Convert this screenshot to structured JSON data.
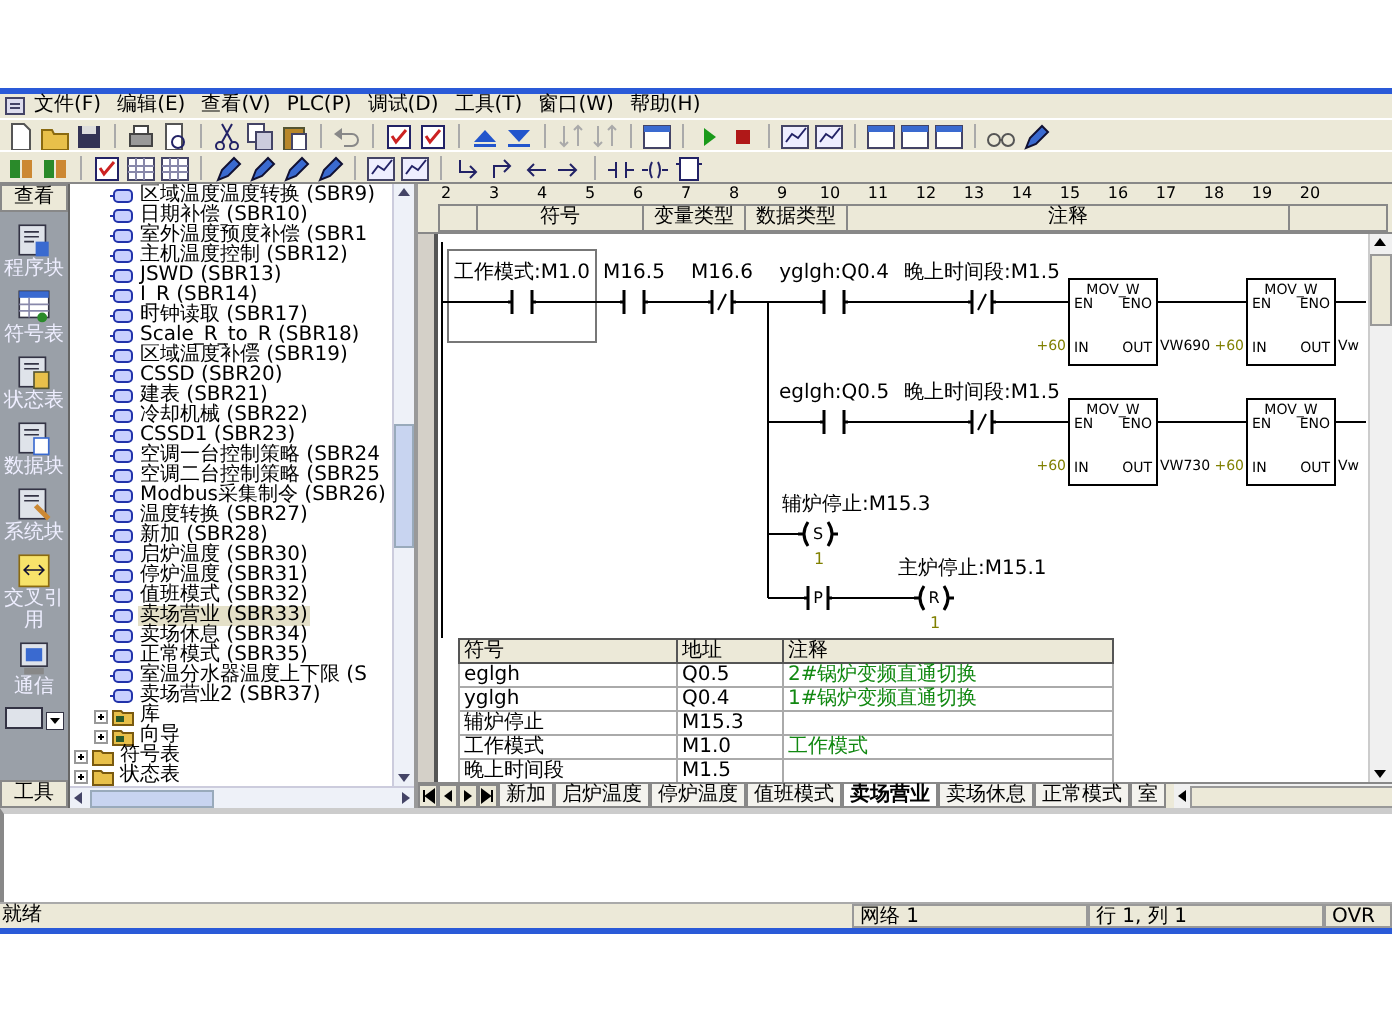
{
  "menu": [
    "文件(F)",
    "编辑(E)",
    "查看(V)",
    "PLC(P)",
    "调试(D)",
    "工具(T)",
    "窗口(W)",
    "帮助(H)"
  ],
  "navbar": {
    "title": "查看",
    "items": [
      "程序块",
      "符号表",
      "状态表",
      "数据块",
      "系统块",
      "交叉引用",
      "通信"
    ],
    "footer": "工具"
  },
  "tree": {
    "sub_items": [
      {
        "kind": "subroutine",
        "label": "区域温度温度转换 (SBR9)",
        "selected": false
      },
      {
        "kind": "subroutine",
        "label": "日期补偿 (SBR10)",
        "selected": false
      },
      {
        "kind": "subroutine",
        "label": "室外温度预度补偿 (SBR1",
        "selected": false
      },
      {
        "kind": "subroutine",
        "label": "主机温度控制 (SBR12)",
        "selected": false
      },
      {
        "kind": "subroutine",
        "label": "JSWD (SBR13)",
        "selected": false
      },
      {
        "kind": "subroutine",
        "label": "I_R (SBR14)",
        "selected": false
      },
      {
        "kind": "subroutine",
        "label": "时钟读取 (SBR17)",
        "selected": false
      },
      {
        "kind": "subroutine",
        "label": "Scale_R_to_R (SBR18)",
        "selected": false
      },
      {
        "kind": "subroutine",
        "label": "区域温度补偿 (SBR19)",
        "selected": false
      },
      {
        "kind": "subroutine",
        "label": "CSSD (SBR20)",
        "selected": false
      },
      {
        "kind": "subroutine",
        "label": "建表 (SBR21)",
        "selected": false
      },
      {
        "kind": "subroutine",
        "label": "冷却机械 (SBR22)",
        "selected": false
      },
      {
        "kind": "subroutine",
        "label": "CSSD1 (SBR23)",
        "selected": false
      },
      {
        "kind": "subroutine",
        "label": "空调一台控制策略 (SBR24",
        "selected": false
      },
      {
        "kind": "subroutine",
        "label": "空调二台控制策略 (SBR25",
        "selected": false
      },
      {
        "kind": "subroutine",
        "label": "Modbus采集制令 (SBR26)",
        "selected": false
      },
      {
        "kind": "subroutine",
        "label": "温度转换 (SBR27)",
        "selected": false
      },
      {
        "kind": "subroutine",
        "label": "新加 (SBR28)",
        "selected": false
      },
      {
        "kind": "subroutine",
        "label": "启炉温度 (SBR30)",
        "selected": false
      },
      {
        "kind": "subroutine",
        "label": "停炉温度 (SBR31)",
        "selected": false
      },
      {
        "kind": "subroutine",
        "label": "值班模式 (SBR32)",
        "selected": false
      },
      {
        "kind": "subroutine",
        "label": "卖场营业 (SBR33)",
        "selected": true
      },
      {
        "kind": "subroutine",
        "label": "卖场休息 (SBR34)",
        "selected": false
      },
      {
        "kind": "subroutine",
        "label": "正常模式 (SBR35)",
        "selected": false
      },
      {
        "kind": "subroutine",
        "label": "室温分水器温度上下限 (S",
        "selected": false
      },
      {
        "kind": "subroutine",
        "label": "卖场营业2 (SBR37)",
        "selected": false
      },
      {
        "kind": "folder",
        "label": "库",
        "expanded": false
      },
      {
        "kind": "folder",
        "label": "向导",
        "expanded": false
      }
    ],
    "top_items": [
      {
        "label": "符号表",
        "expanded": false
      },
      {
        "label": "状态表",
        "expanded": false
      }
    ]
  },
  "editor": {
    "ruler": [
      "2",
      "3",
      "4",
      "5",
      "6",
      "7",
      "8",
      "9",
      "10",
      "11",
      "12",
      "13",
      "14",
      "15",
      "16",
      "17",
      "18",
      "19",
      "20"
    ],
    "columns": [
      "符号",
      "变量类型",
      "数据类型",
      "注释"
    ],
    "ladder": {
      "contacts": [
        {
          "kind": "no",
          "label": "工作模式:M1.0"
        },
        {
          "kind": "no",
          "label": "M16.5"
        },
        {
          "kind": "nc",
          "label": "M16.6"
        },
        {
          "kind": "no",
          "label": "yglgh:Q0.4"
        },
        {
          "kind": "nc",
          "label": "晚上时间段:M1.5"
        },
        {
          "kind": "no",
          "label": "eglgh:Q0.5"
        },
        {
          "kind": "nc",
          "label": "晚上时间段:M1.5"
        },
        {
          "kind": "pulse",
          "symbol": "P"
        }
      ],
      "boxes": [
        {
          "title": "MOV_W",
          "en": "EN",
          "eno": "ENO",
          "in": "IN",
          "out": "OUT",
          "in_value": "+60",
          "out_value": "VW690"
        },
        {
          "title": "MOV_W",
          "en": "EN",
          "eno": "ENO",
          "in": "IN",
          "out": "OUT",
          "in_value": "+60",
          "out_value": "Vw"
        },
        {
          "title": "MOV_W",
          "en": "EN",
          "eno": "ENO",
          "in": "IN",
          "out": "OUT",
          "in_value": "+60",
          "out_value": "VW730"
        },
        {
          "title": "MOV_W",
          "en": "EN",
          "eno": "ENO",
          "in": "IN",
          "out": "OUT",
          "in_value": "+60",
          "out_value": "Vw"
        }
      ],
      "coils": [
        {
          "label": "辅炉停止:M15.3",
          "symbol": "S",
          "count": "1"
        },
        {
          "label": "主炉停止:M15.1",
          "symbol": "R",
          "count": "1"
        }
      ]
    },
    "symbol_table": {
      "columns": [
        "符号",
        "地址",
        "注释"
      ],
      "rows": [
        [
          "eglgh",
          "Q0.5",
          "2#锅炉变频直通切换"
        ],
        [
          "yglgh",
          "Q0.4",
          "1#锅炉变频直通切换"
        ],
        [
          "辅炉停止",
          "M15.3",
          ""
        ],
        [
          "工作模式",
          "M1.0",
          "工作模式"
        ],
        [
          "晚上时间段",
          "M1.5",
          ""
        ]
      ]
    },
    "tabs": [
      {
        "label": "新加",
        "selected": false
      },
      {
        "label": "启炉温度",
        "selected": false
      },
      {
        "label": "停炉温度",
        "selected": false
      },
      {
        "label": "值班模式",
        "selected": false
      },
      {
        "label": "卖场营业",
        "selected": true
      },
      {
        "label": "卖场休息",
        "selected": false
      },
      {
        "label": "正常模式",
        "selected": false
      },
      {
        "label": "室",
        "selected": false
      }
    ]
  },
  "status_bar": {
    "message": "就绪",
    "network": "网络 1",
    "position": "行 1, 列 1",
    "mode": "OVR"
  }
}
